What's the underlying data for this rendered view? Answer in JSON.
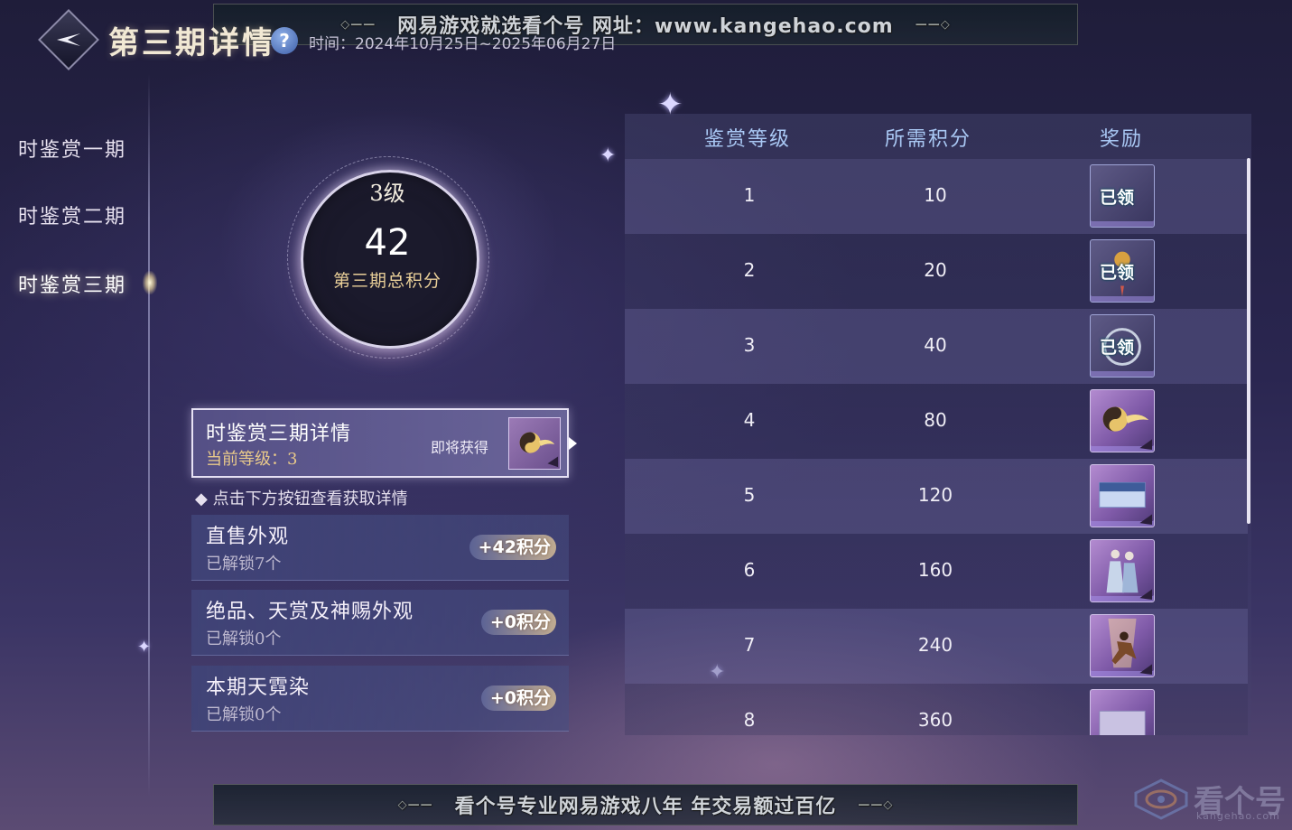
{
  "header": {
    "title": "第三期详情",
    "help_icon": "question-icon",
    "help_glyph": "?",
    "date_range": "时间：2024年10月25日~2025年06月27日"
  },
  "banner_top": "网易游戏就选看个号  网址：www.kangehao.com",
  "banner_bottom": "看个号专业网易游戏八年  年交易额过百亿",
  "nav": {
    "items": [
      {
        "label": "时鉴赏一期"
      },
      {
        "label": "时鉴赏二期"
      },
      {
        "label": "时鉴赏三期"
      }
    ],
    "active_index": 2
  },
  "ring": {
    "level": "3级",
    "score": "42",
    "caption": "第三期总积分"
  },
  "detail_card": {
    "title": "时鉴赏三期详情",
    "current_level": "当前等级：3",
    "upcoming_label": "即将获得",
    "reward_icon": "taiji-cloud-icon"
  },
  "hint": "◆ 点击下方按钮查看获取详情",
  "sources": [
    {
      "name": "直售外观",
      "count": "已解锁7个",
      "points": "+42积分"
    },
    {
      "name": "绝品、天赏及神赐外观",
      "count": "已解锁0个",
      "points": "+0积分"
    },
    {
      "name": "本期天霓染",
      "count": "已解锁0个",
      "points": "+0积分"
    }
  ],
  "table": {
    "headers": [
      "鉴赏等级",
      "所需积分",
      "奖励"
    ],
    "claimed_label": "已领",
    "rows": [
      {
        "level": "1",
        "points": "10",
        "reward_icon": "claimed-reward-icon",
        "claimed": true
      },
      {
        "level": "2",
        "points": "20",
        "reward_icon": "lantern-reward-icon",
        "claimed": true
      },
      {
        "level": "3",
        "points": "40",
        "reward_icon": "ring-reward-icon",
        "claimed": true
      },
      {
        "level": "4",
        "points": "80",
        "reward_icon": "taiji-cloud-icon",
        "claimed": false
      },
      {
        "level": "5",
        "points": "120",
        "reward_icon": "card-reward-icon",
        "claimed": false
      },
      {
        "level": "6",
        "points": "160",
        "reward_icon": "couple-figures-icon",
        "claimed": false
      },
      {
        "level": "7",
        "points": "240",
        "reward_icon": "warrior-action-icon",
        "claimed": false
      },
      {
        "level": "8",
        "points": "360",
        "reward_icon": "card-reward-icon",
        "claimed": false
      }
    ]
  },
  "watermark": {
    "text": "看个号",
    "url": "kangehao.com"
  },
  "colors": {
    "header_text": "#a9c8f4",
    "points_gold": "#e9cf98",
    "reward_purple": "#7f5aa8"
  }
}
